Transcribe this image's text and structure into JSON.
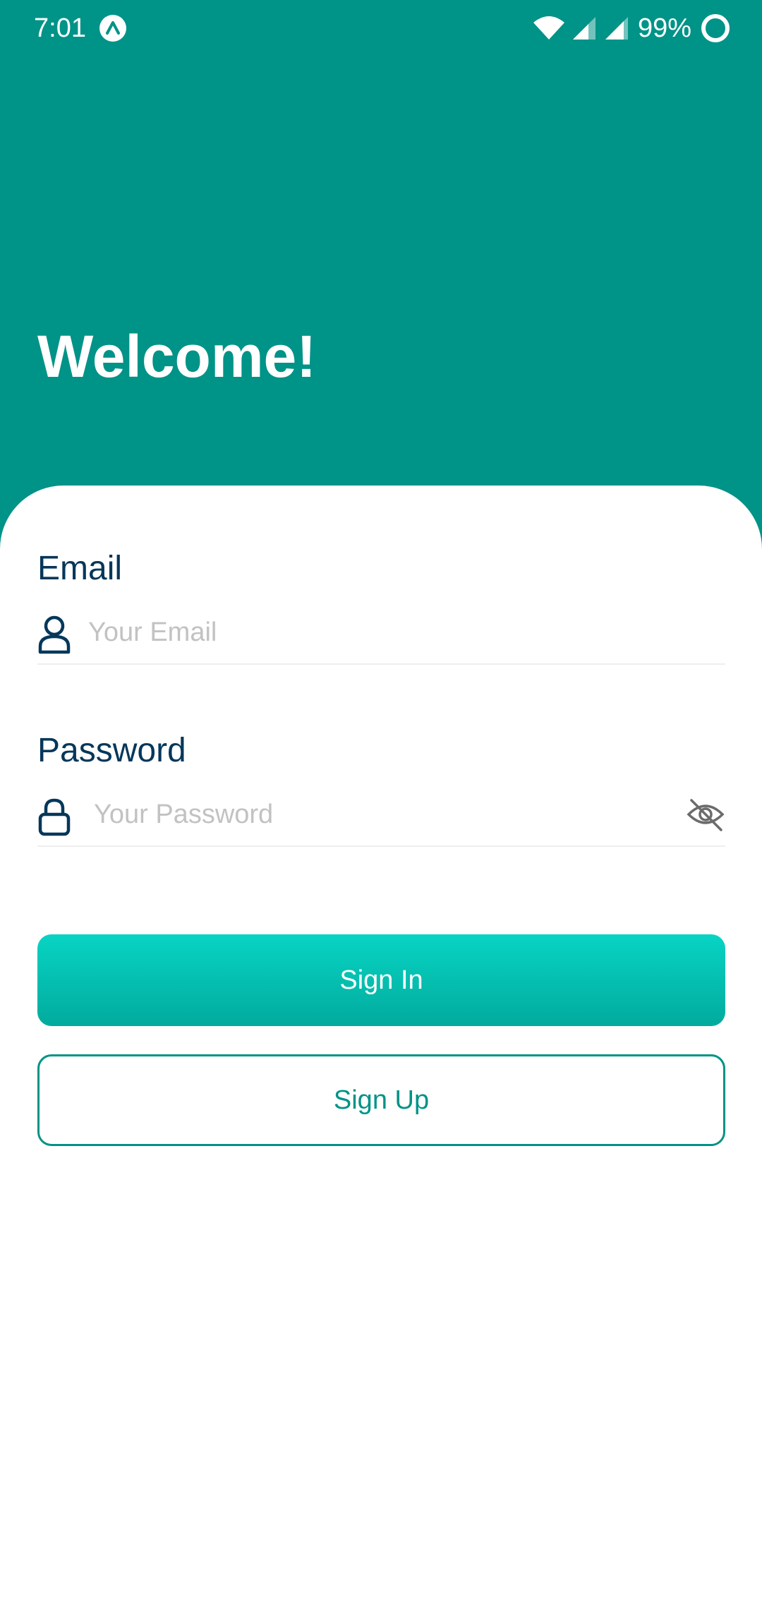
{
  "status_bar": {
    "time": "7:01",
    "battery": "99%",
    "icons": [
      "app-notification-icon",
      "wifi-icon",
      "signal-icon",
      "signal-icon",
      "battery-saver-icon"
    ]
  },
  "header": {
    "title": "Welcome!"
  },
  "form": {
    "email": {
      "label": "Email",
      "placeholder": "Your Email",
      "value": "",
      "icon": "user-icon"
    },
    "password": {
      "label": "Password",
      "placeholder": "Your Password",
      "value": "",
      "icon": "lock-icon",
      "toggle_icon": "eye-off-icon"
    }
  },
  "actions": {
    "sign_in_label": "Sign In",
    "sign_up_label": "Sign Up"
  },
  "colors": {
    "primary": "#009387",
    "gradient_start": "#08d4c4",
    "gradient_end": "#01ab9d",
    "label_text": "#05375a",
    "placeholder_text": "#c2c2c2"
  }
}
